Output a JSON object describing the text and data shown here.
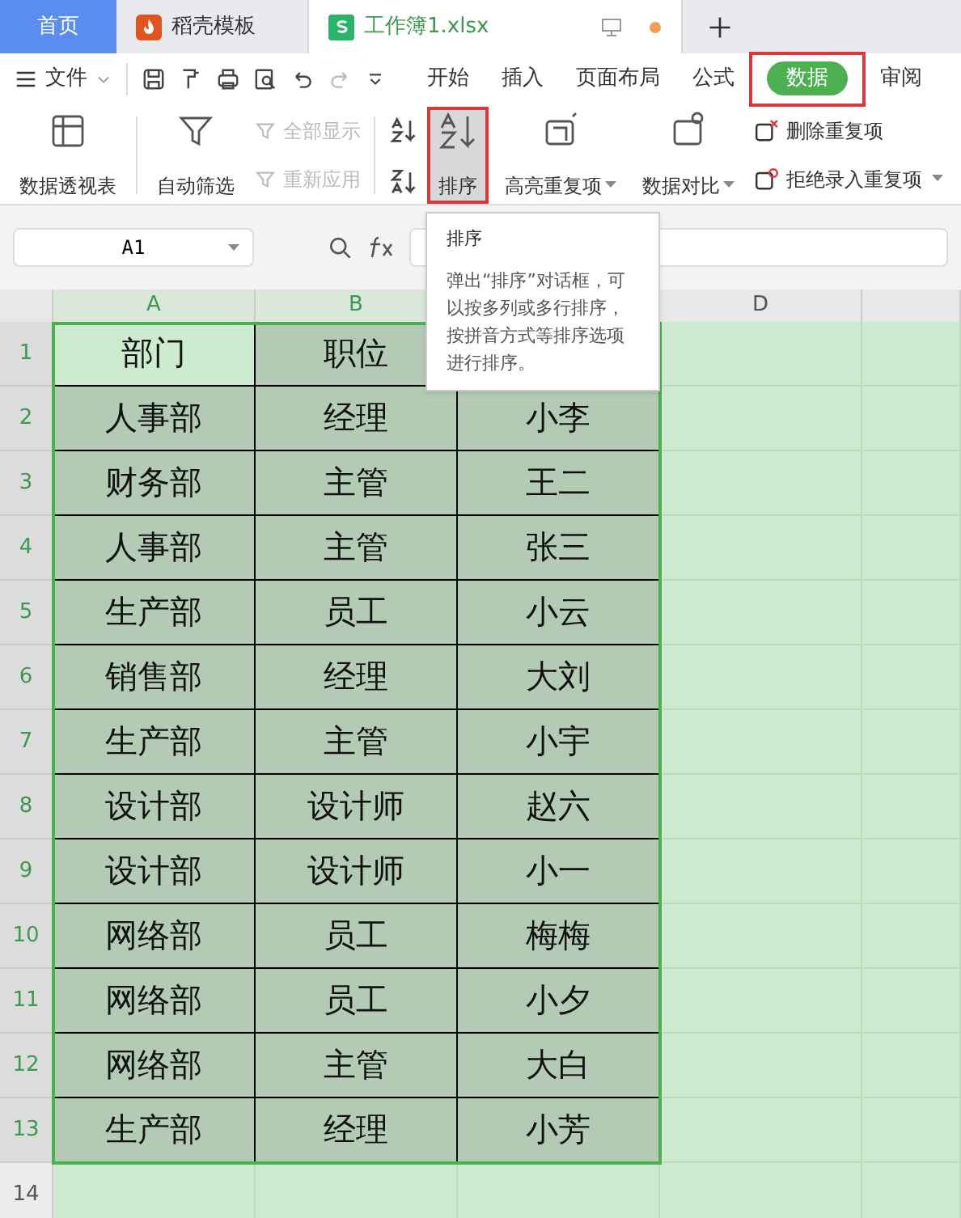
{
  "tabs": [
    {
      "label": "首页",
      "kind": "home",
      "selected": false
    },
    {
      "label": "稻壳模板",
      "kind": "docer",
      "selected": false
    },
    {
      "label": "工作簿1.xlsx",
      "kind": "sheet",
      "selected": true
    }
  ],
  "menu": {
    "file": "文件",
    "items": [
      {
        "label": "开始",
        "selected": false,
        "highlighted": false
      },
      {
        "label": "插入",
        "selected": false,
        "highlighted": false
      },
      {
        "label": "页面布局",
        "selected": false,
        "highlighted": false
      },
      {
        "label": "公式",
        "selected": false,
        "highlighted": false
      },
      {
        "label": "数据",
        "selected": true,
        "highlighted": true
      },
      {
        "label": "审阅",
        "selected": false,
        "highlighted": false
      }
    ]
  },
  "ribbon": {
    "pivot": "数据透视表",
    "filter": "自动筛选",
    "show_all": {
      "label": "全部显示",
      "disabled": true
    },
    "reapply": {
      "label": "重新应用",
      "disabled": true
    },
    "sort": {
      "label": "排序",
      "highlighted": true
    },
    "highlight_dup": "高亮重复项",
    "compare": "数据对比",
    "remove_dup": "删除重复项",
    "reject_dup": "拒绝录入重复项"
  },
  "formula_bar": {
    "name_box": "A1"
  },
  "tooltip": {
    "title": "排序",
    "text": "弹出“排序”对话框，可以按多列或多行排序，按拼音方式等排序选项进行排序。"
  },
  "sheet": {
    "columns": [
      "A",
      "B",
      null,
      "D",
      null
    ],
    "rows": [
      {
        "num": "1",
        "cells": [
          "部门",
          "职位"
        ]
      },
      {
        "num": "2",
        "cells": [
          "人事部",
          "经理",
          "小李"
        ]
      },
      {
        "num": "3",
        "cells": [
          "财务部",
          "主管",
          "王二"
        ]
      },
      {
        "num": "4",
        "cells": [
          "人事部",
          "主管",
          "张三"
        ]
      },
      {
        "num": "5",
        "cells": [
          "生产部",
          "员工",
          "小云"
        ]
      },
      {
        "num": "6",
        "cells": [
          "销售部",
          "经理",
          "大刘"
        ]
      },
      {
        "num": "7",
        "cells": [
          "生产部",
          "主管",
          "小宇"
        ]
      },
      {
        "num": "8",
        "cells": [
          "设计部",
          "设计师",
          "赵六"
        ]
      },
      {
        "num": "9",
        "cells": [
          "设计部",
          "设计师",
          "小一"
        ]
      },
      {
        "num": "10",
        "cells": [
          "网络部",
          "员工",
          "梅梅"
        ]
      },
      {
        "num": "11",
        "cells": [
          "网络部",
          "员工",
          "小夕"
        ]
      },
      {
        "num": "12",
        "cells": [
          "网络部",
          "主管",
          "大白"
        ]
      },
      {
        "num": "13",
        "cells": [
          "生产部",
          "经理",
          "小芳"
        ]
      },
      {
        "num": "14",
        "cells": []
      }
    ]
  }
}
